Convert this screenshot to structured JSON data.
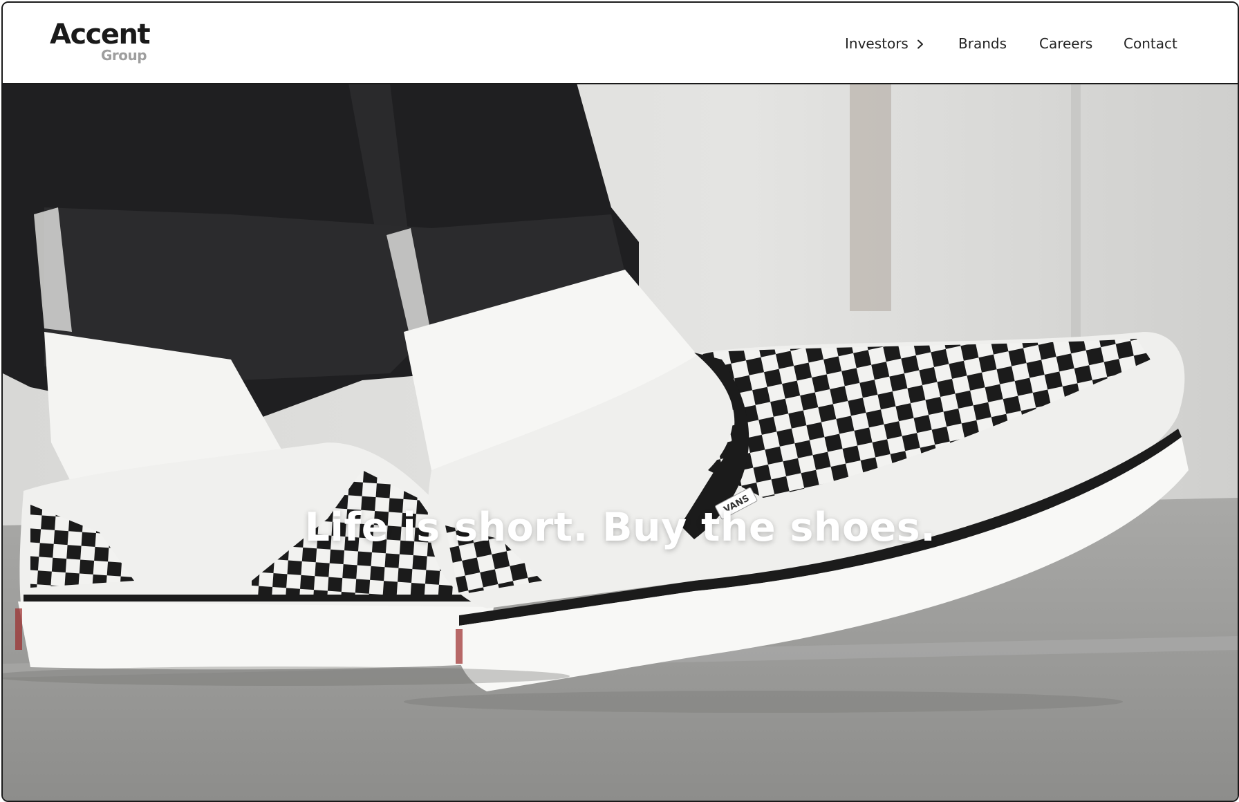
{
  "header": {
    "logo": {
      "main": "Accent",
      "sub": "Group"
    },
    "nav": [
      {
        "label": "Investors",
        "icon": "chevron-right-icon"
      },
      {
        "label": "Brands"
      },
      {
        "label": "Careers"
      },
      {
        "label": "Contact"
      }
    ]
  },
  "hero": {
    "headline": "Life is short. Buy the shoes.",
    "shoe_brand": "VANS"
  },
  "colors": {
    "text": "#222222",
    "logo_sub": "#9e9e9e",
    "hero_text": "#ffffff"
  }
}
